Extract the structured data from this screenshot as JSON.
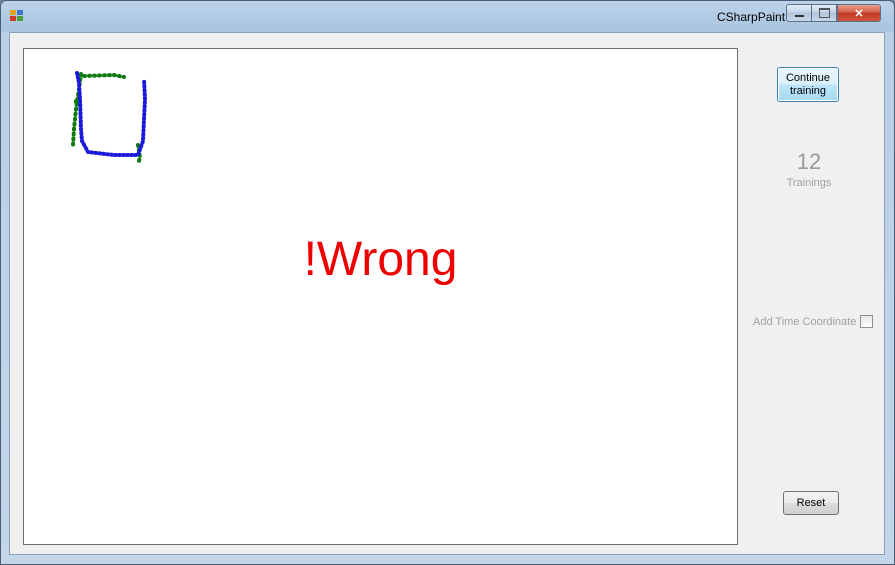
{
  "window": {
    "title": "CSharpPaint",
    "icon": "app-icon",
    "minimize_icon": "minimize-icon",
    "maximize_icon": "maximize-icon",
    "close_icon": "close-icon"
  },
  "canvas": {
    "result_text": "!Wrong",
    "colors": {
      "result": "#ee0000",
      "stroke_a": "#1a1adc",
      "stroke_b": "#0f7a0f"
    }
  },
  "side": {
    "continue_label": "Continue training",
    "training_count": "12",
    "training_label": "Trainings",
    "time_coordinate_label": "Add Time Coordinate",
    "time_coordinate_checked": false,
    "reset_label": "Reset"
  }
}
